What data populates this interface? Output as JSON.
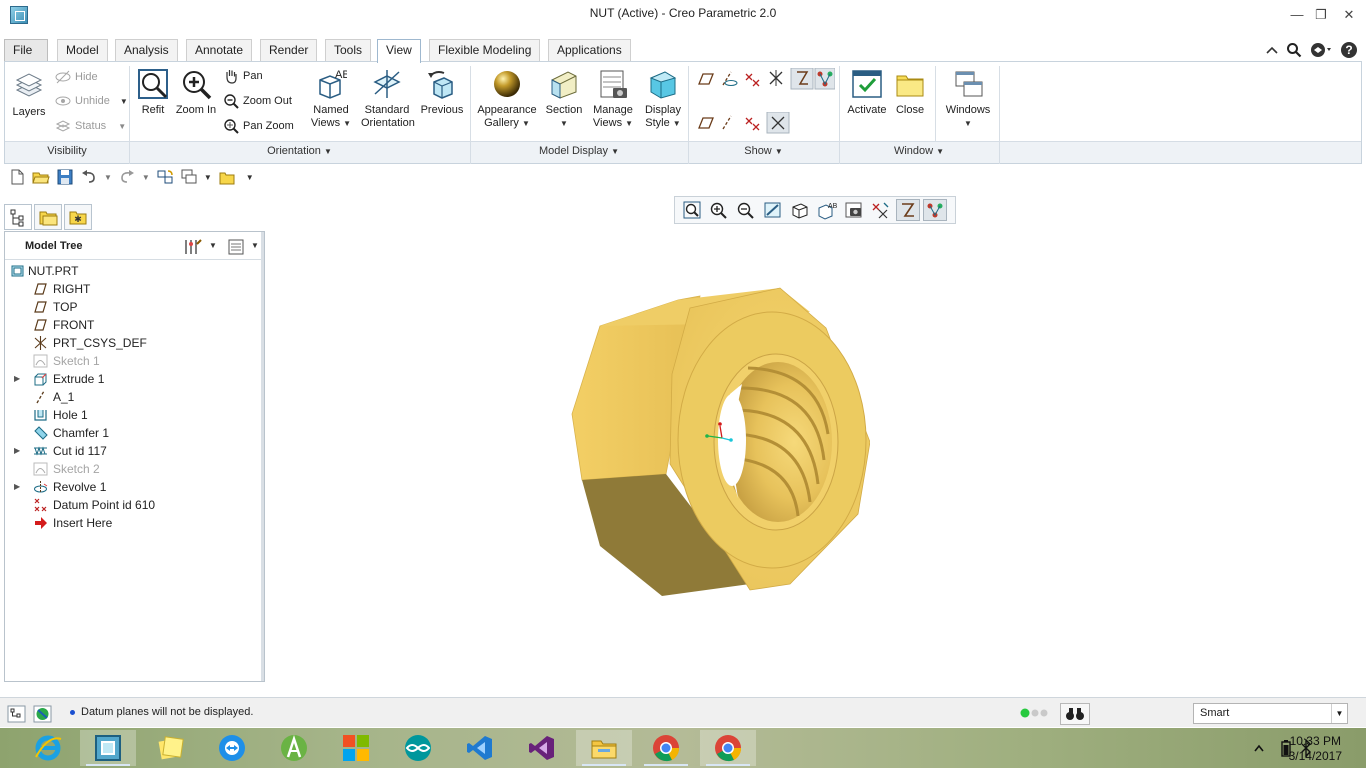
{
  "window": {
    "title": "NUT (Active) - Creo Parametric 2.0",
    "minimize_glyph": "—",
    "restore_glyph": "❐",
    "close_glyph": "✕"
  },
  "tabs": [
    {
      "label": "File"
    },
    {
      "label": "Model"
    },
    {
      "label": "Analysis"
    },
    {
      "label": "Annotate"
    },
    {
      "label": "Render"
    },
    {
      "label": "Tools"
    },
    {
      "label": "View"
    },
    {
      "label": "Flexible Modeling"
    },
    {
      "label": "Applications"
    }
  ],
  "active_tab": "View",
  "ribbon": {
    "visibility": {
      "group_label": "Visibility",
      "layers": "Layers",
      "hide": "Hide",
      "unhide": "Unhide",
      "status": "Status"
    },
    "orientation": {
      "group_label": "Orientation",
      "refit": "Refit",
      "zoom_in": "Zoom In",
      "pan": "Pan",
      "zoom_out": "Zoom Out",
      "pan_zoom": "Pan Zoom",
      "named_views_1": "Named",
      "named_views_2": "Views",
      "standard_orientation_1": "Standard",
      "standard_orientation_2": "Orientation",
      "previous": "Previous"
    },
    "model_display": {
      "group_label": "Model Display",
      "appearance_gallery_1": "Appearance",
      "appearance_gallery_2": "Gallery",
      "section": "Section",
      "manage_views_1": "Manage",
      "manage_views_2": "Views",
      "display_style_1": "Display",
      "display_style_2": "Style"
    },
    "show": {
      "group_label": "Show"
    },
    "window_group": {
      "group_label": "Window",
      "activate": "Activate",
      "close": "Close",
      "windows": "Windows"
    }
  },
  "model_tree": {
    "title": "Model Tree",
    "items": [
      {
        "label": "NUT.PRT"
      },
      {
        "label": "RIGHT"
      },
      {
        "label": "TOP"
      },
      {
        "label": "FRONT"
      },
      {
        "label": "PRT_CSYS_DEF"
      },
      {
        "label": "Sketch 1"
      },
      {
        "label": "Extrude 1"
      },
      {
        "label": "A_1"
      },
      {
        "label": "Hole 1"
      },
      {
        "label": "Chamfer 1"
      },
      {
        "label": "Cut id 117"
      },
      {
        "label": "Sketch 2"
      },
      {
        "label": "Revolve 1"
      },
      {
        "label": "Datum Point id 610"
      },
      {
        "label": "Insert Here"
      }
    ]
  },
  "status": {
    "message": "Datum planes will not be displayed.",
    "filter_value": "Smart"
  },
  "taskbar": {
    "time": "10:33 PM",
    "date": "3/14/2017"
  },
  "colors": {
    "nut_front": "#f0cc63",
    "nut_shadow": "#8f7a38",
    "nut_side": "#c9a94a",
    "accent_blue": "#1a4fd0"
  }
}
